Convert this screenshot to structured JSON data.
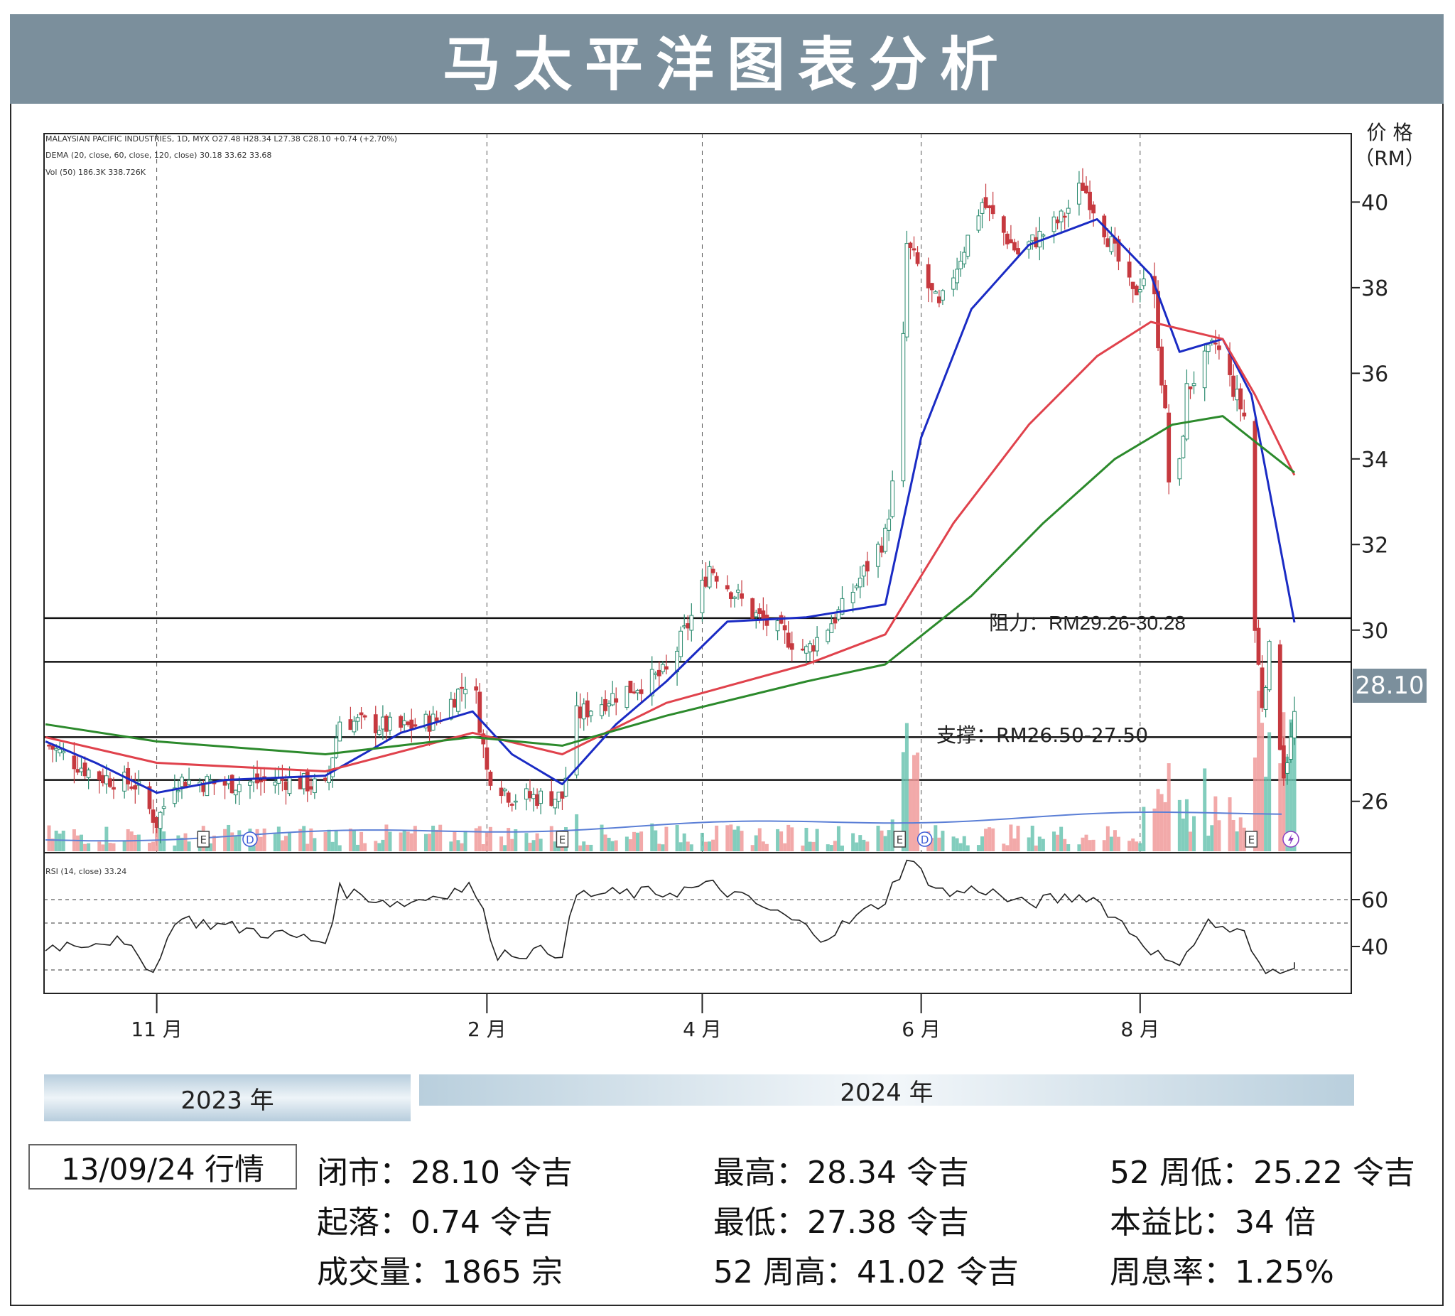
{
  "header": {
    "title": "马太平洋图表分析"
  },
  "legend": {
    "line1": "MALAYSIAN PACIFIC INDUSTRIES, 1D, MYX  O27.48  H28.34  L27.38  C28.10 +0.74 (+2.70%)",
    "line2": "DEMA (20, close, 60, close, 120, close)  30.18  33.62  33.68",
    "line3": "Vol (50)  186.3K  338.726K",
    "rsi": "RSI (14, close)  33.24"
  },
  "axis": {
    "price_unit": "价 格",
    "price_unit2": "（RM）",
    "price_ticks": [
      "40",
      "38",
      "36",
      "34",
      "32",
      "30",
      "26"
    ],
    "rsi_ticks": [
      "60",
      "40"
    ],
    "month_ticks": [
      "11 月",
      "2 月",
      "4 月",
      "6 月",
      "8 月"
    ],
    "last_price": "28.10"
  },
  "annotations": {
    "resistance": "阻力：RM29.26-30.28",
    "support": "支撑：RM26.50-27.50"
  },
  "event_markers": [
    "E",
    "D",
    "E",
    "E",
    "D",
    "E"
  ],
  "years": {
    "y2023": "2023 年",
    "y2024": "2024 年"
  },
  "stats": {
    "date_label": "13/09/24 行情",
    "close": "闭市：28.10 令吉",
    "high": "最高：28.34 令吉",
    "low52": "52 周低：25.22 令吉",
    "change": "起落：0.74 令吉",
    "low": "最低：27.38 令吉",
    "pe": "本益比：34 倍",
    "volume": "成交量：1865 宗",
    "high52": "52 周高：41.02 令吉",
    "yield": "周息率：1.25%"
  },
  "colors": {
    "title_bar": "#7b8f9c",
    "up": "#6cc4b2",
    "down": "#f09a9a",
    "dema20": "#1a2bc4",
    "dema60": "#e0424c",
    "dema120": "#2c8a2c",
    "volume_ma": "#5b7fd6",
    "price_label_bg": "#7b8f9c"
  },
  "chart_data": {
    "type": "candlestick",
    "title": "马太平洋图表分析",
    "ylabel": "价格 (RM)",
    "ylim": [
      24.8,
      41.6
    ],
    "x_range": [
      "2023-10-01",
      "2024-09-13"
    ],
    "x_ticks": [
      {
        "label": "11 月",
        "date": "2023-11-01"
      },
      {
        "label": "2 月",
        "date": "2024-02-01"
      },
      {
        "label": "4 月",
        "date": "2024-04-01"
      },
      {
        "label": "6 月",
        "date": "2024-06-01"
      },
      {
        "label": "8 月",
        "date": "2024-08-01"
      }
    ],
    "last": {
      "open": 27.48,
      "high": 28.34,
      "low": 27.38,
      "close": 28.1,
      "change": 0.74,
      "change_pct": 2.7
    },
    "close_path": [
      {
        "date": "2023-10-02",
        "close": 27.3
      },
      {
        "date": "2023-10-15",
        "close": 26.6
      },
      {
        "date": "2023-10-26",
        "close": 26.4
      },
      {
        "date": "2023-11-01",
        "close": 25.5
      },
      {
        "date": "2023-11-06",
        "close": 26.5
      },
      {
        "date": "2023-11-20",
        "close": 26.4
      },
      {
        "date": "2023-12-08",
        "close": 26.5
      },
      {
        "date": "2023-12-18",
        "close": 26.3
      },
      {
        "date": "2023-12-22",
        "close": 27.9
      },
      {
        "date": "2024-01-08",
        "close": 27.7
      },
      {
        "date": "2024-01-18",
        "close": 27.9
      },
      {
        "date": "2024-01-28",
        "close": 29.0
      },
      {
        "date": "2024-02-01",
        "close": 26.7
      },
      {
        "date": "2024-02-08",
        "close": 26.1
      },
      {
        "date": "2024-02-22",
        "close": 26.1
      },
      {
        "date": "2024-02-26",
        "close": 28.0
      },
      {
        "date": "2024-03-08",
        "close": 28.5
      },
      {
        "date": "2024-03-22",
        "close": 29.0
      },
      {
        "date": "2024-03-30",
        "close": 30.5
      },
      {
        "date": "2024-04-03",
        "close": 31.5
      },
      {
        "date": "2024-04-15",
        "close": 30.4
      },
      {
        "date": "2024-04-30",
        "close": 29.5
      },
      {
        "date": "2024-05-10",
        "close": 30.5
      },
      {
        "date": "2024-05-22",
        "close": 32.2
      },
      {
        "date": "2024-05-26",
        "close": 34.5
      },
      {
        "date": "2024-05-28",
        "close": 39.0
      },
      {
        "date": "2024-06-06",
        "close": 37.5
      },
      {
        "date": "2024-06-18",
        "close": 40.0
      },
      {
        "date": "2024-06-28",
        "close": 38.8
      },
      {
        "date": "2024-07-10",
        "close": 39.6
      },
      {
        "date": "2024-07-16",
        "close": 40.4
      },
      {
        "date": "2024-07-22",
        "close": 39.4
      },
      {
        "date": "2024-07-30",
        "close": 37.8
      },
      {
        "date": "2024-08-04",
        "close": 38.6
      },
      {
        "date": "2024-08-08",
        "close": 35.0
      },
      {
        "date": "2024-08-10",
        "close": 32.0
      },
      {
        "date": "2024-08-14",
        "close": 35.6
      },
      {
        "date": "2024-08-22",
        "close": 36.7
      },
      {
        "date": "2024-08-30",
        "close": 35.0
      },
      {
        "date": "2024-09-02",
        "close": 30.0
      },
      {
        "date": "2024-09-04",
        "close": 28.3
      },
      {
        "date": "2024-09-06",
        "close": 29.5
      },
      {
        "date": "2024-09-10",
        "close": 26.7
      },
      {
        "date": "2024-09-12",
        "close": 27.4
      },
      {
        "date": "2024-09-13",
        "close": 28.1
      }
    ],
    "series": [
      {
        "name": "DEMA 20",
        "last": 30.18,
        "points": [
          {
            "date": "2023-10-01",
            "value": 27.4
          },
          {
            "date": "2023-10-15",
            "value": 26.9
          },
          {
            "date": "2023-11-01",
            "value": 26.2
          },
          {
            "date": "2023-11-20",
            "value": 26.5
          },
          {
            "date": "2023-12-18",
            "value": 26.6
          },
          {
            "date": "2024-01-08",
            "value": 27.6
          },
          {
            "date": "2024-01-28",
            "value": 28.1
          },
          {
            "date": "2024-02-08",
            "value": 27.1
          },
          {
            "date": "2024-02-22",
            "value": 26.4
          },
          {
            "date": "2024-03-08",
            "value": 27.8
          },
          {
            "date": "2024-03-22",
            "value": 28.8
          },
          {
            "date": "2024-04-08",
            "value": 30.2
          },
          {
            "date": "2024-04-30",
            "value": 30.3
          },
          {
            "date": "2024-05-22",
            "value": 30.6
          },
          {
            "date": "2024-06-01",
            "value": 34.5
          },
          {
            "date": "2024-06-15",
            "value": 37.5
          },
          {
            "date": "2024-07-01",
            "value": 39.0
          },
          {
            "date": "2024-07-20",
            "value": 39.6
          },
          {
            "date": "2024-08-04",
            "value": 38.3
          },
          {
            "date": "2024-08-12",
            "value": 36.5
          },
          {
            "date": "2024-08-24",
            "value": 36.8
          },
          {
            "date": "2024-09-01",
            "value": 35.5
          },
          {
            "date": "2024-09-13",
            "value": 30.18
          }
        ]
      },
      {
        "name": "DEMA 60",
        "last": 33.62,
        "points": [
          {
            "date": "2023-10-01",
            "value": 27.5
          },
          {
            "date": "2023-11-01",
            "value": 26.9
          },
          {
            "date": "2023-12-18",
            "value": 26.7
          },
          {
            "date": "2024-01-28",
            "value": 27.6
          },
          {
            "date": "2024-02-22",
            "value": 27.1
          },
          {
            "date": "2024-03-22",
            "value": 28.3
          },
          {
            "date": "2024-04-30",
            "value": 29.2
          },
          {
            "date": "2024-05-22",
            "value": 29.9
          },
          {
            "date": "2024-06-10",
            "value": 32.5
          },
          {
            "date": "2024-07-01",
            "value": 34.8
          },
          {
            "date": "2024-07-20",
            "value": 36.4
          },
          {
            "date": "2024-08-04",
            "value": 37.2
          },
          {
            "date": "2024-08-24",
            "value": 36.8
          },
          {
            "date": "2024-09-02",
            "value": 35.5
          },
          {
            "date": "2024-09-13",
            "value": 33.62
          }
        ]
      },
      {
        "name": "DEMA 120",
        "last": 33.68,
        "points": [
          {
            "date": "2023-10-01",
            "value": 27.8
          },
          {
            "date": "2023-11-01",
            "value": 27.4
          },
          {
            "date": "2023-12-18",
            "value": 27.1
          },
          {
            "date": "2024-01-28",
            "value": 27.5
          },
          {
            "date": "2024-02-22",
            "value": 27.3
          },
          {
            "date": "2024-03-22",
            "value": 28.0
          },
          {
            "date": "2024-04-30",
            "value": 28.8
          },
          {
            "date": "2024-05-22",
            "value": 29.2
          },
          {
            "date": "2024-06-15",
            "value": 30.8
          },
          {
            "date": "2024-07-05",
            "value": 32.5
          },
          {
            "date": "2024-07-25",
            "value": 34.0
          },
          {
            "date": "2024-08-10",
            "value": 34.8
          },
          {
            "date": "2024-08-24",
            "value": 35.0
          },
          {
            "date": "2024-09-13",
            "value": 33.68
          }
        ]
      }
    ],
    "rsi": {
      "name": "RSI (14, close)",
      "last": 33.24,
      "ylim": [
        20,
        80
      ],
      "ref_lines": [
        60,
        50,
        30
      ],
      "points": [
        {
          "date": "2023-10-01",
          "value": 40
        },
        {
          "date": "2023-10-20",
          "value": 43
        },
        {
          "date": "2023-11-01",
          "value": 30
        },
        {
          "date": "2023-11-06",
          "value": 52
        },
        {
          "date": "2023-12-18",
          "value": 42
        },
        {
          "date": "2023-12-22",
          "value": 64
        },
        {
          "date": "2024-01-08",
          "value": 58
        },
        {
          "date": "2024-01-28",
          "value": 66
        },
        {
          "date": "2024-02-04",
          "value": 37
        },
        {
          "date": "2024-02-22",
          "value": 38
        },
        {
          "date": "2024-02-26",
          "value": 62
        },
        {
          "date": "2024-03-22",
          "value": 63
        },
        {
          "date": "2024-04-04",
          "value": 66
        },
        {
          "date": "2024-04-25",
          "value": 52
        },
        {
          "date": "2024-05-05",
          "value": 44
        },
        {
          "date": "2024-05-22",
          "value": 60
        },
        {
          "date": "2024-05-28",
          "value": 77
        },
        {
          "date": "2024-06-08",
          "value": 62
        },
        {
          "date": "2024-06-18",
          "value": 65
        },
        {
          "date": "2024-06-28",
          "value": 58
        },
        {
          "date": "2024-07-18",
          "value": 62
        },
        {
          "date": "2024-08-01",
          "value": 43
        },
        {
          "date": "2024-08-10",
          "value": 31
        },
        {
          "date": "2024-08-20",
          "value": 50
        },
        {
          "date": "2024-08-30",
          "value": 45
        },
        {
          "date": "2024-09-04",
          "value": 28
        },
        {
          "date": "2024-09-13",
          "value": 33.24
        }
      ]
    },
    "volume": {
      "name": "Vol (50)",
      "last": "186.3K",
      "average": "338.726K"
    },
    "levels": [
      {
        "name": "阻力",
        "low": 29.26,
        "high": 30.28
      },
      {
        "name": "支撑",
        "low": 26.5,
        "high": 27.5
      }
    ]
  }
}
